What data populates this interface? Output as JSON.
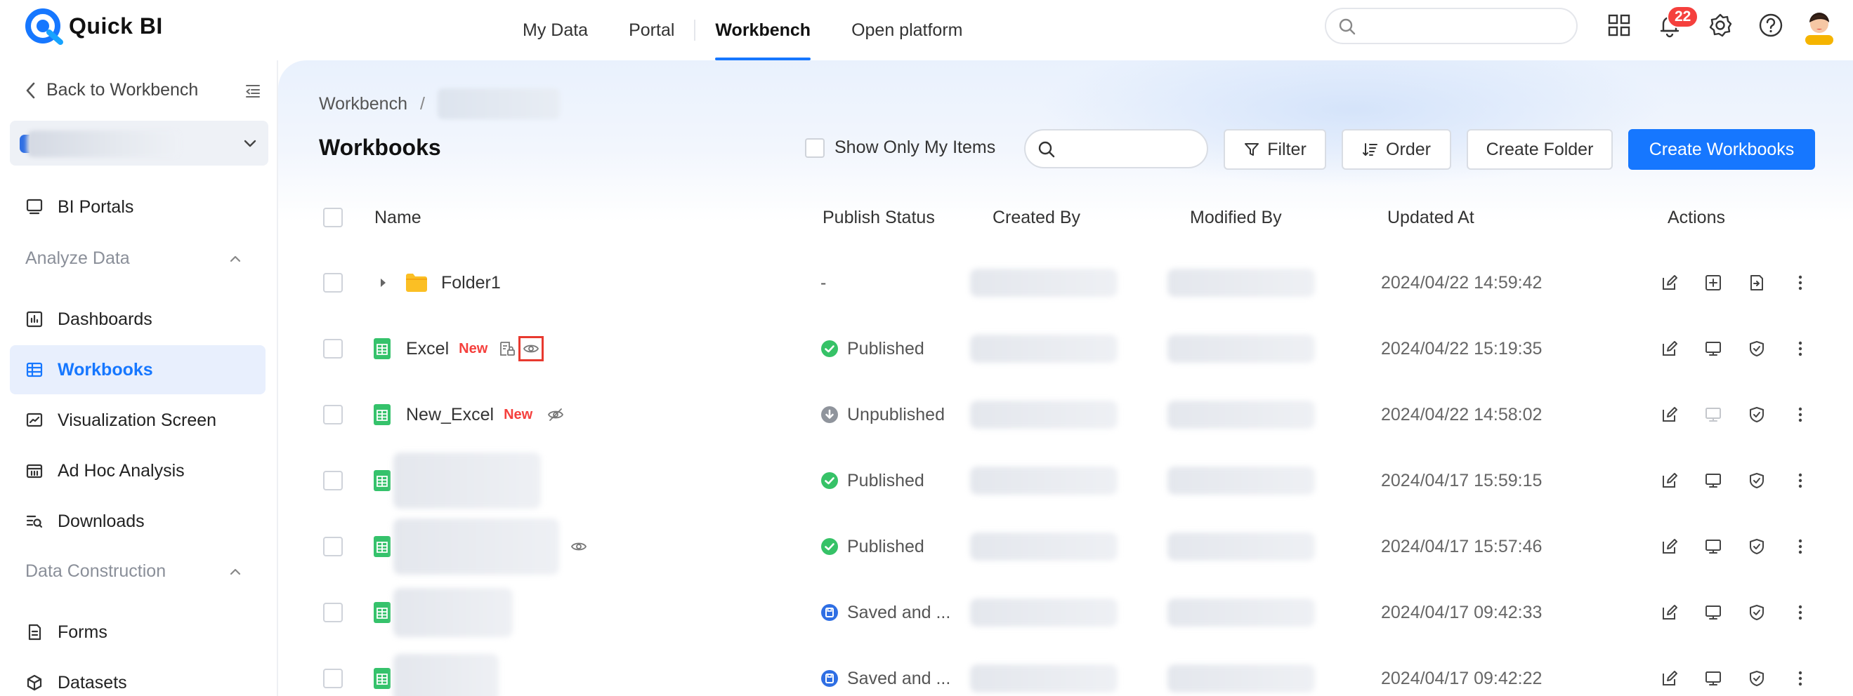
{
  "app": {
    "name": "Quick BI"
  },
  "topnav": {
    "items": [
      "My Data",
      "Portal",
      "Workbench",
      "Open platform"
    ],
    "active": "Workbench"
  },
  "header": {
    "search_placeholder": "",
    "notifications_count": "22"
  },
  "sidebar": {
    "back_label": "Back to Workbench",
    "items": {
      "bi_portals": "BI Portals",
      "analyze_data": "Analyze Data",
      "dashboards": "Dashboards",
      "workbooks": "Workbooks",
      "visualization_screen": "Visualization Screen",
      "ad_hoc_analysis": "Ad Hoc Analysis",
      "downloads": "Downloads",
      "data_construction": "Data Construction",
      "forms": "Forms",
      "datasets": "Datasets"
    },
    "active": "Workbooks"
  },
  "breadcrumb": {
    "root": "Workbench",
    "separator": "/"
  },
  "page": {
    "title": "Workbooks",
    "show_only_mine": "Show Only My Items",
    "filter": "Filter",
    "order": "Order",
    "create_folder": "Create Folder",
    "create_workbooks": "Create Workbooks"
  },
  "table": {
    "columns": [
      "Name",
      "Publish Status",
      "Created By",
      "Modified By",
      "Updated At",
      "Actions"
    ],
    "rows": [
      {
        "name": "Folder1",
        "type": "folder",
        "status": "-",
        "updated": "2024/04/22 14:59:42"
      },
      {
        "name": "Excel",
        "tag": "New",
        "type": "sheet",
        "status": "Published",
        "updated": "2024/04/22 15:19:35"
      },
      {
        "name": "New_Excel",
        "tag": "New",
        "type": "sheet",
        "status": "Unpublished",
        "updated": "2024/04/22 14:58:02"
      },
      {
        "name": "",
        "type": "sheet",
        "status": "Published",
        "updated": "2024/04/17 15:59:15"
      },
      {
        "name": "",
        "type": "sheet",
        "status": "Published",
        "updated": "2024/04/17 15:57:46"
      },
      {
        "name": "",
        "type": "sheet",
        "status": "Saved and ...",
        "updated": "2024/04/17 09:42:33"
      },
      {
        "name": "",
        "type": "sheet",
        "status": "Saved and ...",
        "updated": "2024/04/17 09:42:22"
      }
    ]
  },
  "colors": {
    "accent": "#1677ff",
    "published": "#36c267",
    "unpublished": "#8f949c",
    "saved": "#2f6fe4",
    "badge": "#f5403d",
    "folder": "#fbbf24",
    "sheet": "#35c26b"
  }
}
